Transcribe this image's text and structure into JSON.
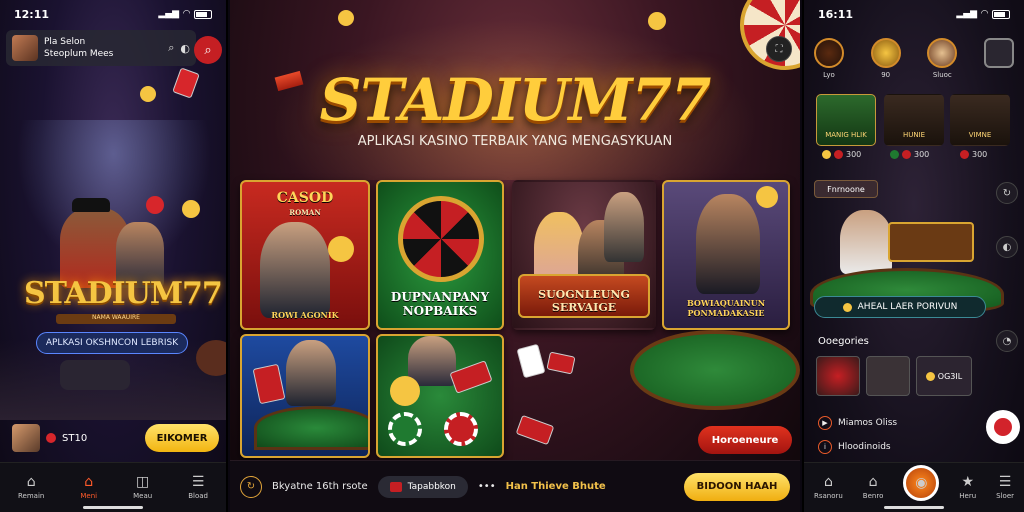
{
  "left_phone": {
    "status_time": "12:11",
    "topbar": {
      "line1": "Pla Selon",
      "line2": "Steoplum Mees"
    },
    "logo": "STADIUM77",
    "logo_sub": "NAMA WAAUIRE",
    "tagline_pill": "APLKASI OKSHNCON LEBRISK",
    "user_amount": "ST10",
    "cta": "EIKOMER",
    "nav": [
      {
        "label": "Remain",
        "icon": "home-icon"
      },
      {
        "label": "Meni",
        "icon": "home-icon"
      },
      {
        "label": "Meau",
        "icon": "game-icon"
      },
      {
        "label": "Bload",
        "icon": "menu-icon"
      }
    ]
  },
  "center": {
    "logo": "STADIUM77",
    "tagline": "APLIKASI KASINO TERBAIK YANG MENGASYKUAN",
    "cards": [
      {
        "title": "CASOD",
        "subtitle": "ROMAN",
        "caption": "ROWI AGONIK"
      },
      {
        "title": "",
        "caption": "DUPNANPANY NOPBAIKS"
      },
      {
        "title": "",
        "caption": "SUOGNLEUNG SERVAIGE"
      },
      {
        "title": "",
        "caption": "BOWIAQUAINUN PONMADAKASIE"
      },
      {
        "title": "",
        "caption": ""
      },
      {
        "title": "",
        "caption": ""
      }
    ],
    "cta_red": "Horoeneure",
    "bar": {
      "item1": "Bkyatne 16th rsote",
      "item2": "Tapabbkon",
      "item3": "Han Thieve Bhute",
      "cta": "BIDOON HAAH"
    }
  },
  "right_phone": {
    "status_time": "16:11",
    "categories": [
      {
        "label": "Lyo"
      },
      {
        "label": "90"
      },
      {
        "label": "Sluoc"
      },
      {
        "label": ""
      }
    ],
    "tiles": [
      {
        "label": "MANIG HLIK"
      },
      {
        "label": "HUNIE"
      },
      {
        "label": "VIMNE"
      }
    ],
    "tile_stats": [
      "300",
      "300",
      "300"
    ],
    "section_pill": "Fnrnoone",
    "dealer_pill": "AHEAL LAER PORIVUN",
    "section_title": "Ooegories",
    "thumb_label": "OG3IL",
    "list": [
      "Miamos Oliss",
      "Hloodinoids"
    ],
    "nav": [
      {
        "label": "Rsanoru",
        "icon": "home-icon"
      },
      {
        "label": "Benro",
        "icon": "home-icon"
      },
      {
        "label": "",
        "icon": "game-icon"
      },
      {
        "label": "Heru",
        "icon": "star-icon"
      },
      {
        "label": "Sloer",
        "icon": "menu-icon"
      }
    ]
  },
  "colors": {
    "gold": "#f5c542",
    "red": "#c51f23",
    "green": "#1f7a30",
    "navy": "#1b2a5c"
  }
}
